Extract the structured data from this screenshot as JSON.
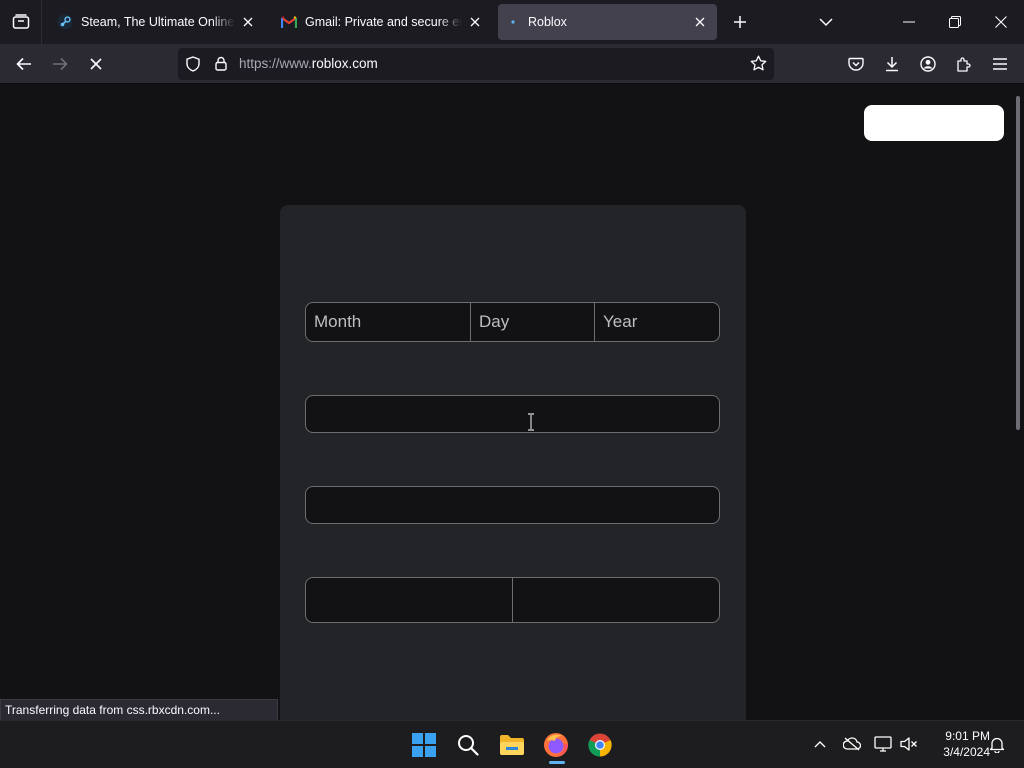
{
  "browser": {
    "tabs": [
      {
        "title": "Steam, The Ultimate Online Game Platform",
        "favicon": "steam-icon",
        "active": false
      },
      {
        "title": "Gmail: Private and secure email at no cost",
        "favicon": "gmail-icon",
        "active": false
      },
      {
        "title": "Roblox",
        "favicon": "loading-dot-icon",
        "active": true
      }
    ],
    "url": {
      "prefix": "https://www.",
      "domain": "roblox.com"
    },
    "status_text": "Transferring data from css.rbxcdn.com..."
  },
  "form": {
    "dob": {
      "month_placeholder": "Month",
      "day_placeholder": "Day",
      "year_placeholder": "Year"
    }
  },
  "taskbar": {
    "apps": [
      "windows-start-icon",
      "search-icon",
      "file-explorer-icon",
      "firefox-icon",
      "chrome-icon"
    ],
    "clock": {
      "time": "9:01 PM",
      "date": "3/4/2024"
    }
  },
  "colors": {
    "page_bg": "#121215",
    "card_bg": "#232427",
    "active_tab": "#42414d",
    "accent": "#5fb2f2"
  }
}
